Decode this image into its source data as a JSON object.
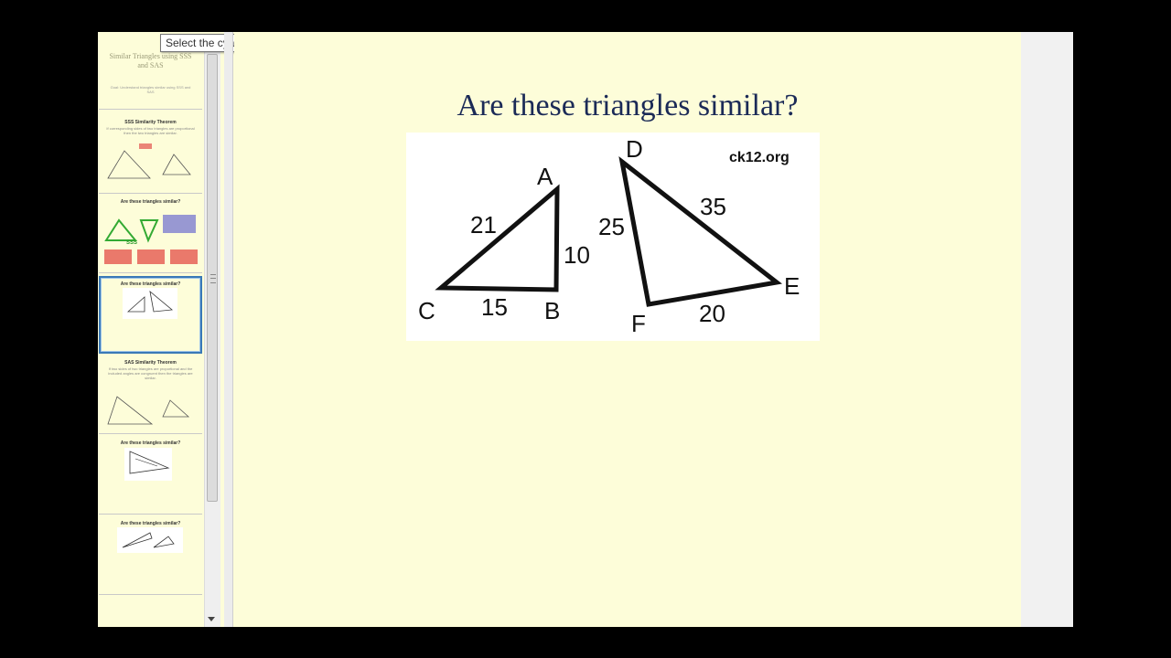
{
  "tooltip": {
    "text": "Select the cyan highlighter."
  },
  "colors": {
    "slide_bg": "#fdfdd9",
    "title": "#1b2a57",
    "selected_border": "#3a79b6"
  },
  "thumbnails": [
    {
      "title": "Similar Triangles using SSS and SAS",
      "body": "Goal: Understand triangles similar using SSS and SAS"
    },
    {
      "title": "SSS Similarity Theorem",
      "body": "If corresponding sides of two triangles are proportional then the two triangles are similar."
    },
    {
      "title": "Are these triangles similar?",
      "body": "SSS"
    },
    {
      "title": "Are these triangles similar?",
      "body": ""
    },
    {
      "title": "SAS Similarity Theorem",
      "body": "If two sides of two triangles are proportional and the included angles are congruent then the triangles are similar."
    },
    {
      "title": "Are these triangles similar?",
      "body": ""
    },
    {
      "title": "Are these triangles similar?",
      "body": ""
    }
  ],
  "slide": {
    "title": "Are these triangles similar?",
    "watermark": "ck12.org",
    "vertices": {
      "A": "A",
      "B": "B",
      "C": "C",
      "D": "D",
      "E": "E",
      "F": "F"
    },
    "side_lengths": {
      "AC": "21",
      "AB": "10",
      "CB": "15",
      "DF": "25",
      "DE": "35",
      "FE": "20"
    }
  }
}
